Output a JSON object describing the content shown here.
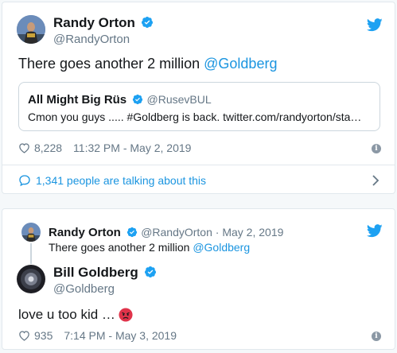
{
  "tweet1": {
    "author_name": "Randy Orton",
    "author_handle": "@RandyOrton",
    "text_prefix": "There goes another 2 million ",
    "text_mention": "@Goldberg",
    "quote": {
      "author_name": "All Might Big Rüs",
      "author_handle": "@RusevBUL",
      "text": "Cmon you guys ..... #Goldberg is back. twitter.com/randyorton/sta…"
    },
    "likes": "8,228",
    "timestamp": "11:32 PM - May 2, 2019",
    "talking": "1,341 people are talking about this"
  },
  "tweet2": {
    "reply_to": {
      "author_name": "Randy Orton",
      "author_handle": "@RandyOrton",
      "separator": " · ",
      "date": "May 2, 2019",
      "text_prefix": "There goes another 2 million ",
      "text_mention": "@Goldberg"
    },
    "author_name": "Bill Goldberg",
    "author_handle": "@Goldberg",
    "text": "love u too kid …",
    "likes": "935",
    "timestamp": "7:14 PM - May 3, 2019"
  },
  "colors": {
    "brand_blue": "#1da1f2",
    "link_blue": "#1b95e0",
    "muted": "#657786"
  },
  "icons": [
    "twitter-bird-icon",
    "verified-badge-icon",
    "heart-icon",
    "info-icon",
    "chevron-right-icon",
    "comment-bubble-icon",
    "angry-face-emoji"
  ]
}
